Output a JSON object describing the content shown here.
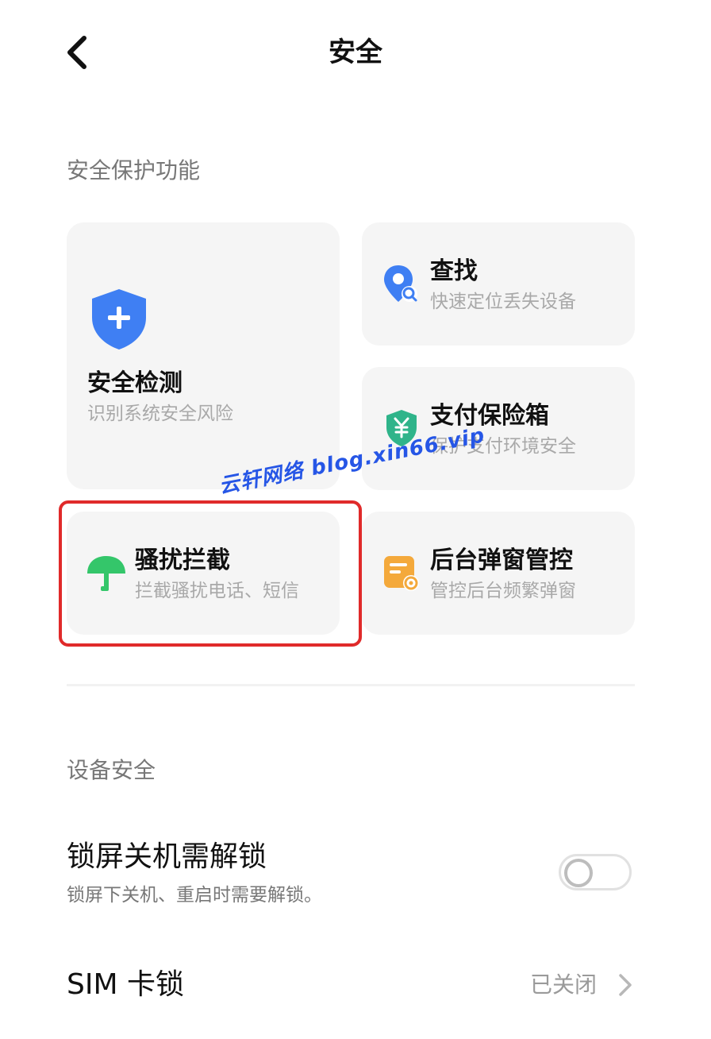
{
  "header": {
    "title": "安全",
    "back_icon": "chevron-left-icon"
  },
  "protection": {
    "section_title": "安全保护功能",
    "cards": [
      {
        "title": "安全检测",
        "subtitle": "识别系统安全风险",
        "icon": "shield-plus-icon",
        "color": "#3f7ff3"
      },
      {
        "title": "查找",
        "subtitle": "快速定位丢失设备",
        "icon": "location-search-icon",
        "color": "#3f7ff3"
      },
      {
        "title": "支付保险箱",
        "subtitle": "保护支付环境安全",
        "icon": "shield-yuan-icon",
        "color": "#2fb48a"
      },
      {
        "title": "骚扰拦截",
        "subtitle": "拦截骚扰电话、短信",
        "icon": "umbrella-icon",
        "color": "#34c66a"
      },
      {
        "title": "后台弹窗管控",
        "subtitle": "管控后台频繁弹窗",
        "icon": "popup-settings-icon",
        "color": "#f4a93b"
      }
    ]
  },
  "watermark": "云轩网络 blog.xin66.vip",
  "highlight_color": "#e02a2a",
  "device": {
    "section_title": "设备安全",
    "lock_shutdown": {
      "title": "锁屏关机需解锁",
      "subtitle": "锁屏下关机、重启时需要解锁。",
      "enabled": false
    },
    "sim_lock": {
      "title": "SIM 卡锁",
      "status": "已关闭"
    }
  }
}
